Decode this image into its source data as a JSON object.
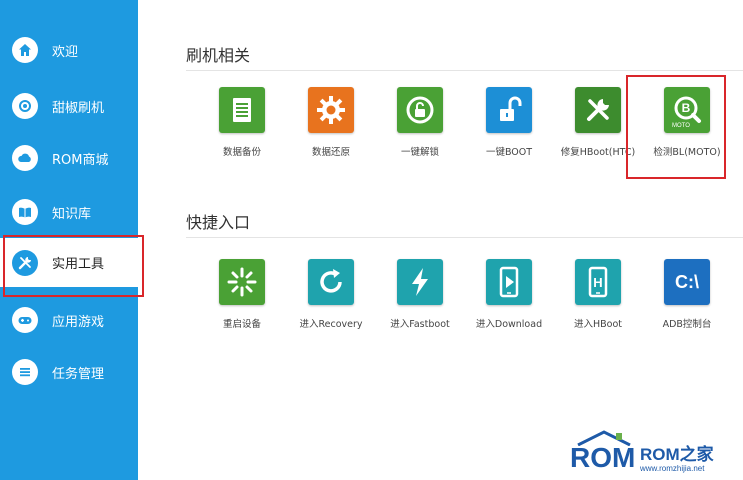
{
  "colors": {
    "sidebar": "#1e9ae0",
    "highlight": "#d9262a",
    "watermark": "#1e5aa8"
  },
  "sidebar": {
    "items": [
      {
        "label": "欢迎",
        "icon": "home-icon"
      },
      {
        "label": "甜椒刷机",
        "icon": "refresh-icon"
      },
      {
        "label": "ROM商城",
        "icon": "cloud-icon"
      },
      {
        "label": "知识库",
        "icon": "book-icon"
      },
      {
        "label": "实用工具",
        "icon": "tools-icon",
        "active": true
      },
      {
        "label": "应用游戏",
        "icon": "gamepad-icon"
      },
      {
        "label": "任务管理",
        "icon": "list-icon"
      }
    ]
  },
  "sections": [
    {
      "title": "刷机相关",
      "tiles": [
        {
          "label": "数据备份",
          "icon": "document-icon",
          "color": "#4aa135"
        },
        {
          "label": "数据还原",
          "icon": "gear-icon",
          "color": "#e8731e"
        },
        {
          "label": "一键解锁",
          "icon": "unlock-circle-icon",
          "color": "#4aa135"
        },
        {
          "label": "一键BOOT",
          "icon": "padlock-open-icon",
          "color": "#1d8fd6"
        },
        {
          "label": "修复HBoot(HTC)",
          "icon": "wrench-icon",
          "color": "#3d8c2e"
        },
        {
          "label": "检测BL(MOTO)",
          "icon": "magnifier-b-icon",
          "color": "#4aa135",
          "badge": "MOTO"
        }
      ]
    },
    {
      "title": "快捷入口",
      "tiles": [
        {
          "label": "重启设备",
          "icon": "burst-icon",
          "color": "#4aa135"
        },
        {
          "label": "进入Recovery",
          "icon": "reload-icon",
          "color": "#1fa3ad"
        },
        {
          "label": "进入Fastboot",
          "icon": "lightning-icon",
          "color": "#1fa3ad"
        },
        {
          "label": "进入Download",
          "icon": "phone-download-icon",
          "color": "#1fa3ad"
        },
        {
          "label": "进入HBoot",
          "icon": "phone-h-icon",
          "color": "#1fa3ad"
        },
        {
          "label": "ADB控制台",
          "icon": "console-icon",
          "color": "#1d6fc0",
          "text": "C:\\"
        }
      ]
    }
  ],
  "watermark": {
    "main": "ROM",
    "sub": "ROM之家",
    "url": "www.romzhijia.net"
  }
}
